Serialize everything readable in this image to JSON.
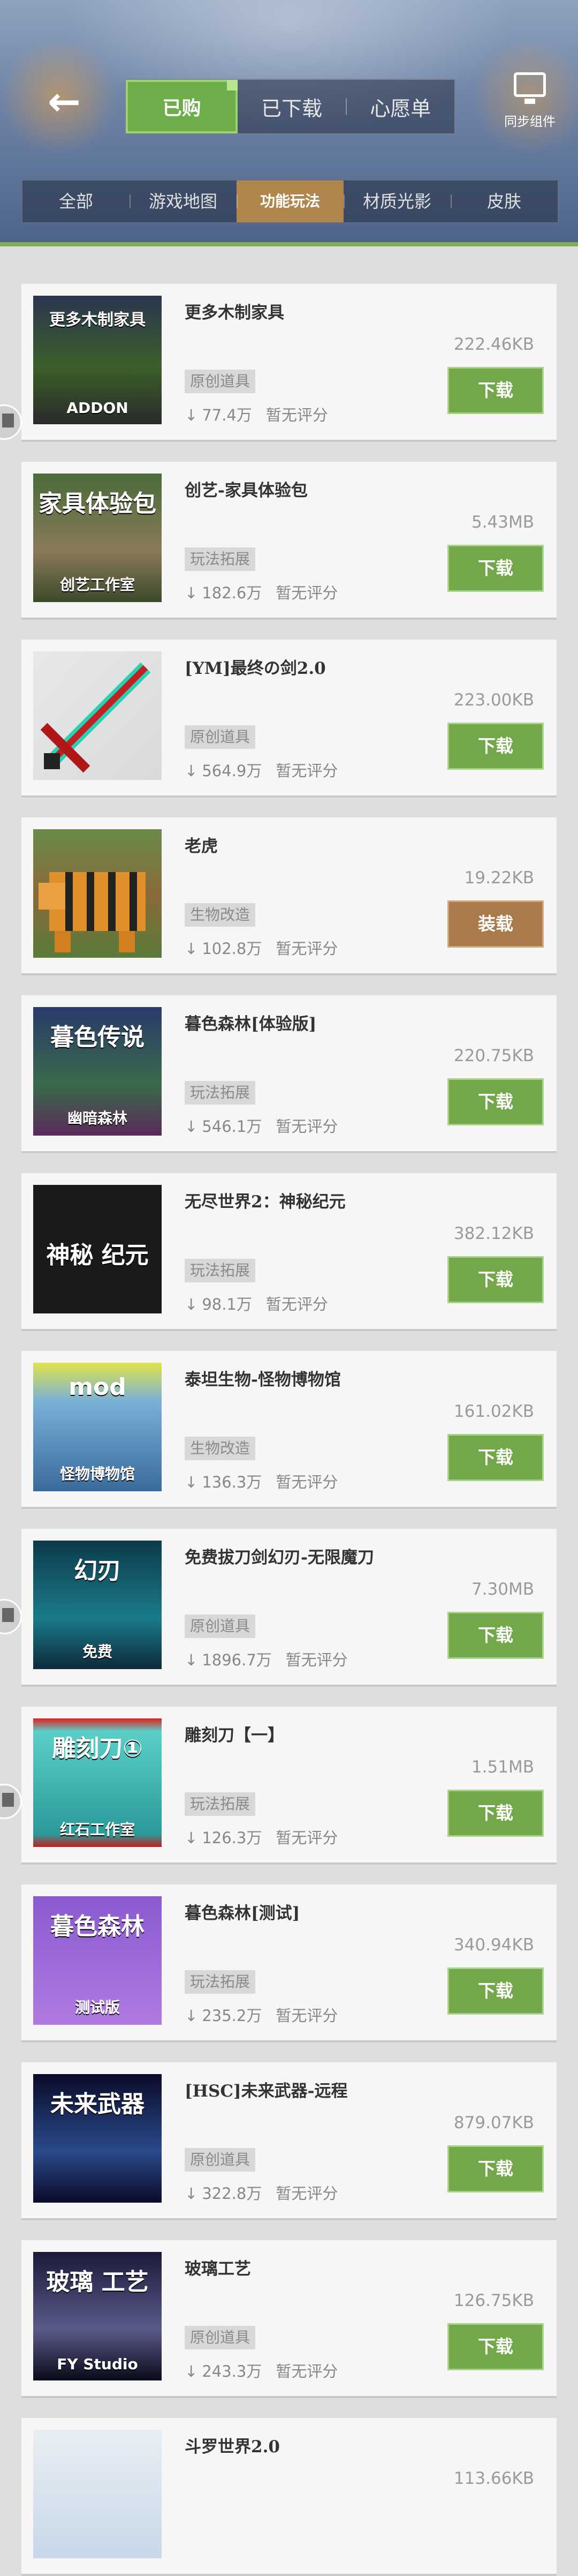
{
  "header": {
    "tabs": [
      "已购",
      "已下载",
      "心愿单"
    ],
    "sync_label": "同步组件",
    "back_icon": "arrow-left-icon",
    "categories": [
      "全部",
      "游戏地图",
      "功能玩法",
      "材质光影",
      "皮肤"
    ]
  },
  "colors": {
    "accent_green": "#72a84a",
    "install_brown": "#a87a4c",
    "active_category": "#b0864c"
  },
  "items": [
    {
      "title": "更多木制家具",
      "size": "222.46KB",
      "tag": "原创道具",
      "downloads": "77.4万",
      "rating": "暂无评分",
      "action": "下载",
      "thumb_text": "更多木制家具",
      "thumb_sub": "ADDON"
    },
    {
      "title": "创艺-家具体验包",
      "size": "5.43MB",
      "tag": "玩法拓展",
      "downloads": "182.6万",
      "rating": "暂无评分",
      "action": "下载",
      "thumb_text": "家具体验包",
      "thumb_sub": "创艺工作室"
    },
    {
      "title": "[YM]最终の剑2.0",
      "size": "223.00KB",
      "tag": "原创道具",
      "downloads": "564.9万",
      "rating": "暂无评分",
      "action": "下载",
      "thumb_text": "",
      "thumb_sub": ""
    },
    {
      "title": "老虎",
      "size": "19.22KB",
      "tag": "生物改造",
      "downloads": "102.8万",
      "rating": "暂无评分",
      "action": "装载",
      "thumb_text": "",
      "thumb_sub": ""
    },
    {
      "title": "暮色森林[体验版]",
      "size": "220.75KB",
      "tag": "玩法拓展",
      "downloads": "546.1万",
      "rating": "暂无评分",
      "action": "下载",
      "thumb_text": "暮色传说",
      "thumb_sub": "幽暗森林"
    },
    {
      "title": "无尽世界2：神秘纪元",
      "size": "382.12KB",
      "tag": "玩法拓展",
      "downloads": "98.1万",
      "rating": "暂无评分",
      "action": "下载",
      "thumb_text": "神秘",
      "thumb_sub": "纪元"
    },
    {
      "title": "泰坦生物-怪物博物馆",
      "size": "161.02KB",
      "tag": "生物改造",
      "downloads": "136.3万",
      "rating": "暂无评分",
      "action": "下载",
      "thumb_text": "mod",
      "thumb_sub": "怪物博物馆"
    },
    {
      "title": "免费拔刀剑幻刃-无限魔刀",
      "size": "7.30MB",
      "tag": "原创道具",
      "downloads": "1896.7万",
      "rating": "暂无评分",
      "action": "下载",
      "thumb_text": "幻刃",
      "thumb_sub": "免费"
    },
    {
      "title": "雕刻刀【一】",
      "size": "1.51MB",
      "tag": "玩法拓展",
      "downloads": "126.3万",
      "rating": "暂无评分",
      "action": "下载",
      "thumb_text": "雕刻刀①",
      "thumb_sub": "红石工作室"
    },
    {
      "title": "暮色森林[测试]",
      "size": "340.94KB",
      "tag": "玩法拓展",
      "downloads": "235.2万",
      "rating": "暂无评分",
      "action": "下载",
      "thumb_text": "暮色森林",
      "thumb_sub": "测试版"
    },
    {
      "title": "[HSC]未来武器-远程",
      "size": "879.07KB",
      "tag": "原创道具",
      "downloads": "322.8万",
      "rating": "暂无评分",
      "action": "下载",
      "thumb_text": "未来武器",
      "thumb_sub": ""
    },
    {
      "title": "玻璃工艺",
      "size": "126.75KB",
      "tag": "原创道具",
      "downloads": "243.3万",
      "rating": "暂无评分",
      "action": "下载",
      "thumb_text": "玻璃 工艺",
      "thumb_sub": "FY Studio"
    },
    {
      "title": "斗罗世界2.0",
      "size": "113.66KB",
      "tag": "",
      "downloads": "",
      "rating": "",
      "action": "",
      "thumb_text": "",
      "thumb_sub": ""
    }
  ]
}
